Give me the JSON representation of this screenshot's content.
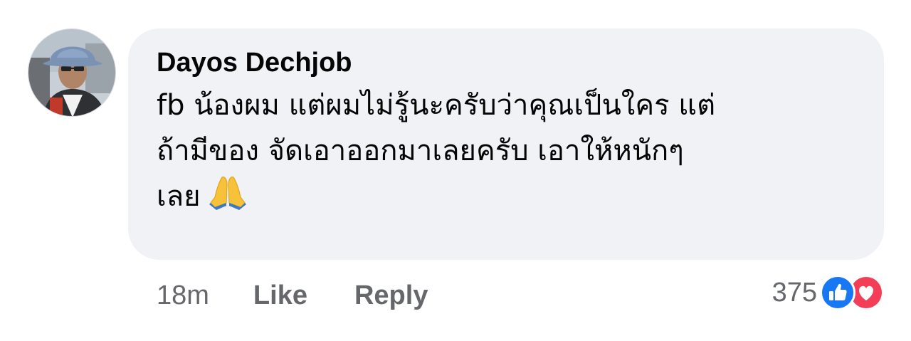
{
  "comment": {
    "author": "Dayos Dechjob",
    "text_lines": [
      "fb น้องผม  แต่ผมไม่รู้นะครับว่าคุณเป็นใคร แต่",
      "ถ้ามีของ จัดเอาออกมาเลยครับ  เอาให้หนักๆ",
      "เลย"
    ],
    "emoji": "folded-hands-emoji",
    "time": "18m",
    "like_label": "Like",
    "reply_label": "Reply",
    "reaction_count": "375",
    "reactions": [
      "like-icon",
      "love-icon"
    ]
  },
  "colors": {
    "bubble": "#f0f2f5",
    "meta_text": "#65676b",
    "like_blue": "#1877f2",
    "love_red": "#f33e58"
  }
}
